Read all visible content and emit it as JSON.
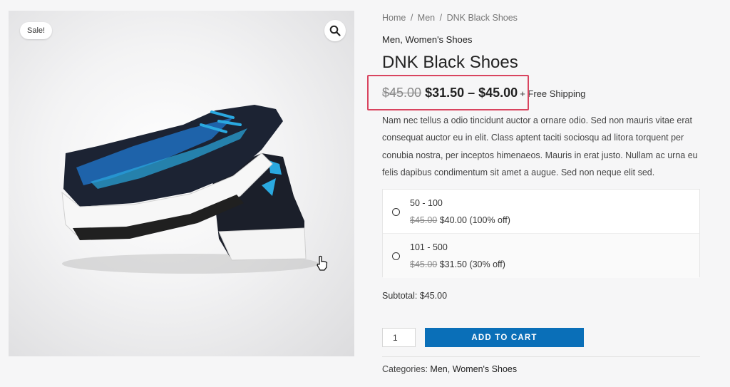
{
  "gallery": {
    "sale_badge": "Sale!",
    "zoom_icon": "search-icon",
    "image_alt": "product-image"
  },
  "breadcrumb": {
    "home": "Home",
    "sep": "/",
    "men": "Men",
    "current": "DNK Black Shoes"
  },
  "categories_top": "Men, Women's Shoes",
  "title": "DNK Black Shoes",
  "price": {
    "regular": "$45.00",
    "range": "$31.50 – $45.00",
    "shipping": "+ Free Shipping"
  },
  "description": "Nam nec tellus a odio tincidunt auctor a ornare odio. Sed non mauris vitae erat consequat auctor eu in elit. Class aptent taciti sociosqu ad litora torquent per conubia nostra, per inceptos himenaeos. Mauris in erat justo. Nullam ac urna eu felis dapibus condimentum sit amet a augue. Sed non neque elit sed.",
  "tiers": [
    {
      "range": "50 - 100",
      "old_price": "$45.00",
      "new_price": "$40.00",
      "discount": "(100% off)"
    },
    {
      "range": "101 - 500",
      "old_price": "$45.00",
      "new_price": "$31.50",
      "discount": "(30% off)"
    }
  ],
  "subtotal": "Subtotal: $45.00",
  "quantity": "1",
  "add_to_cart": "ADD TO CART",
  "categories_bottom": {
    "label": "Categories:",
    "men": "Men",
    "womens": "Women's Shoes"
  },
  "colors": {
    "accent": "#0a6fb8",
    "highlight": "#d9445f"
  }
}
